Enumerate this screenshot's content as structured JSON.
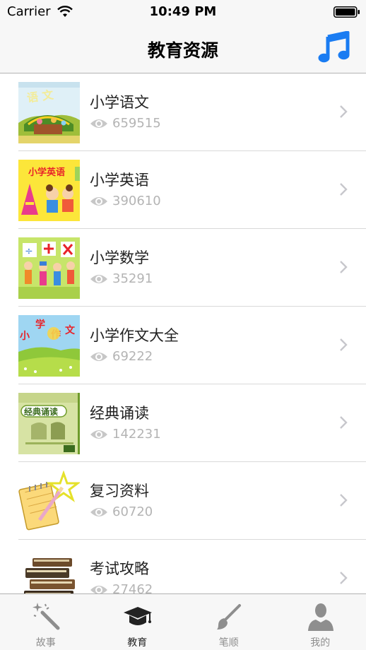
{
  "status": {
    "carrier": "Carrier",
    "time": "10:49 PM"
  },
  "nav": {
    "title": "教育资源",
    "music_icon": "music-note-icon",
    "accent": "#1a7cf2"
  },
  "items": [
    {
      "title": "小学语文",
      "views": "659515"
    },
    {
      "title": "小学英语",
      "views": "390610"
    },
    {
      "title": "小学数学",
      "views": "35291"
    },
    {
      "title": "小学作文大全",
      "views": "69222"
    },
    {
      "title": "经典诵读",
      "views": "142231"
    },
    {
      "title": "复习资料",
      "views": "60720"
    },
    {
      "title": "考试攻略",
      "views": "27462"
    }
  ],
  "thumbs": {
    "english": "小学英语",
    "composition": [
      "小",
      "学",
      "作",
      "文"
    ],
    "classics": "经典诵读"
  },
  "tabs": [
    {
      "label": "故事",
      "icon": "magic-wand-icon",
      "active": false
    },
    {
      "label": "教育",
      "icon": "graduation-cap-icon",
      "active": true
    },
    {
      "label": "笔顺",
      "icon": "brush-icon",
      "active": false
    },
    {
      "label": "我的",
      "icon": "user-icon",
      "active": false
    }
  ]
}
